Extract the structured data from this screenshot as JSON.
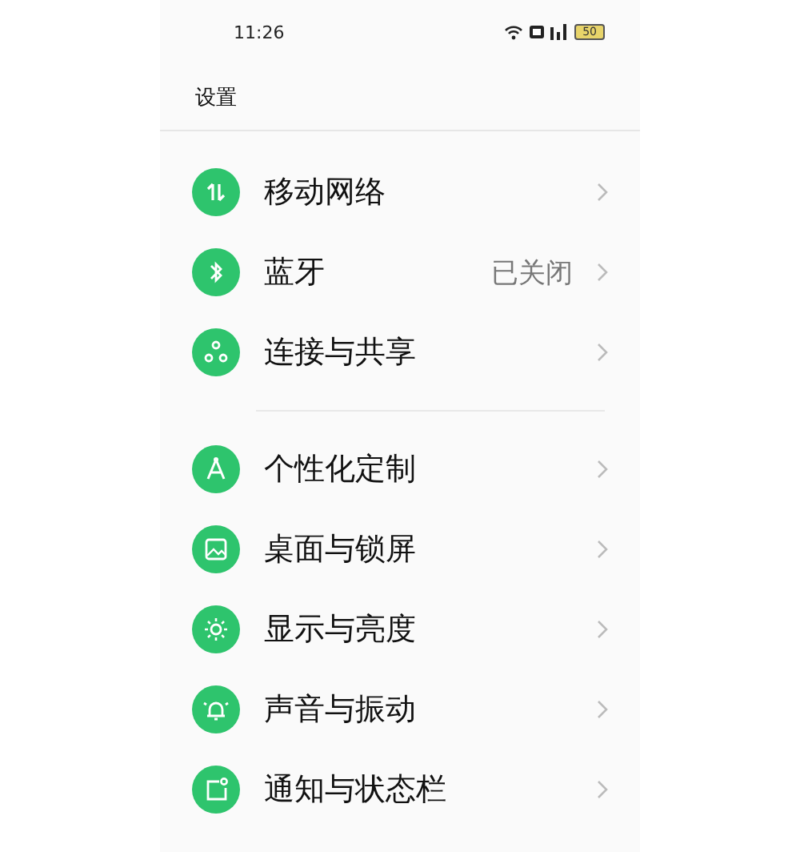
{
  "status_bar": {
    "time": "11:26",
    "battery": "50"
  },
  "header": {
    "title": "设置"
  },
  "sections": [
    {
      "items": [
        {
          "label": "移动网络"
        },
        {
          "label": "蓝牙",
          "value": "已关闭"
        },
        {
          "label": "连接与共享"
        }
      ]
    },
    {
      "items": [
        {
          "label": "个性化定制"
        },
        {
          "label": "桌面与锁屏"
        },
        {
          "label": "显示与亮度"
        },
        {
          "label": "声音与振动"
        },
        {
          "label": "通知与状态栏"
        }
      ]
    }
  ]
}
